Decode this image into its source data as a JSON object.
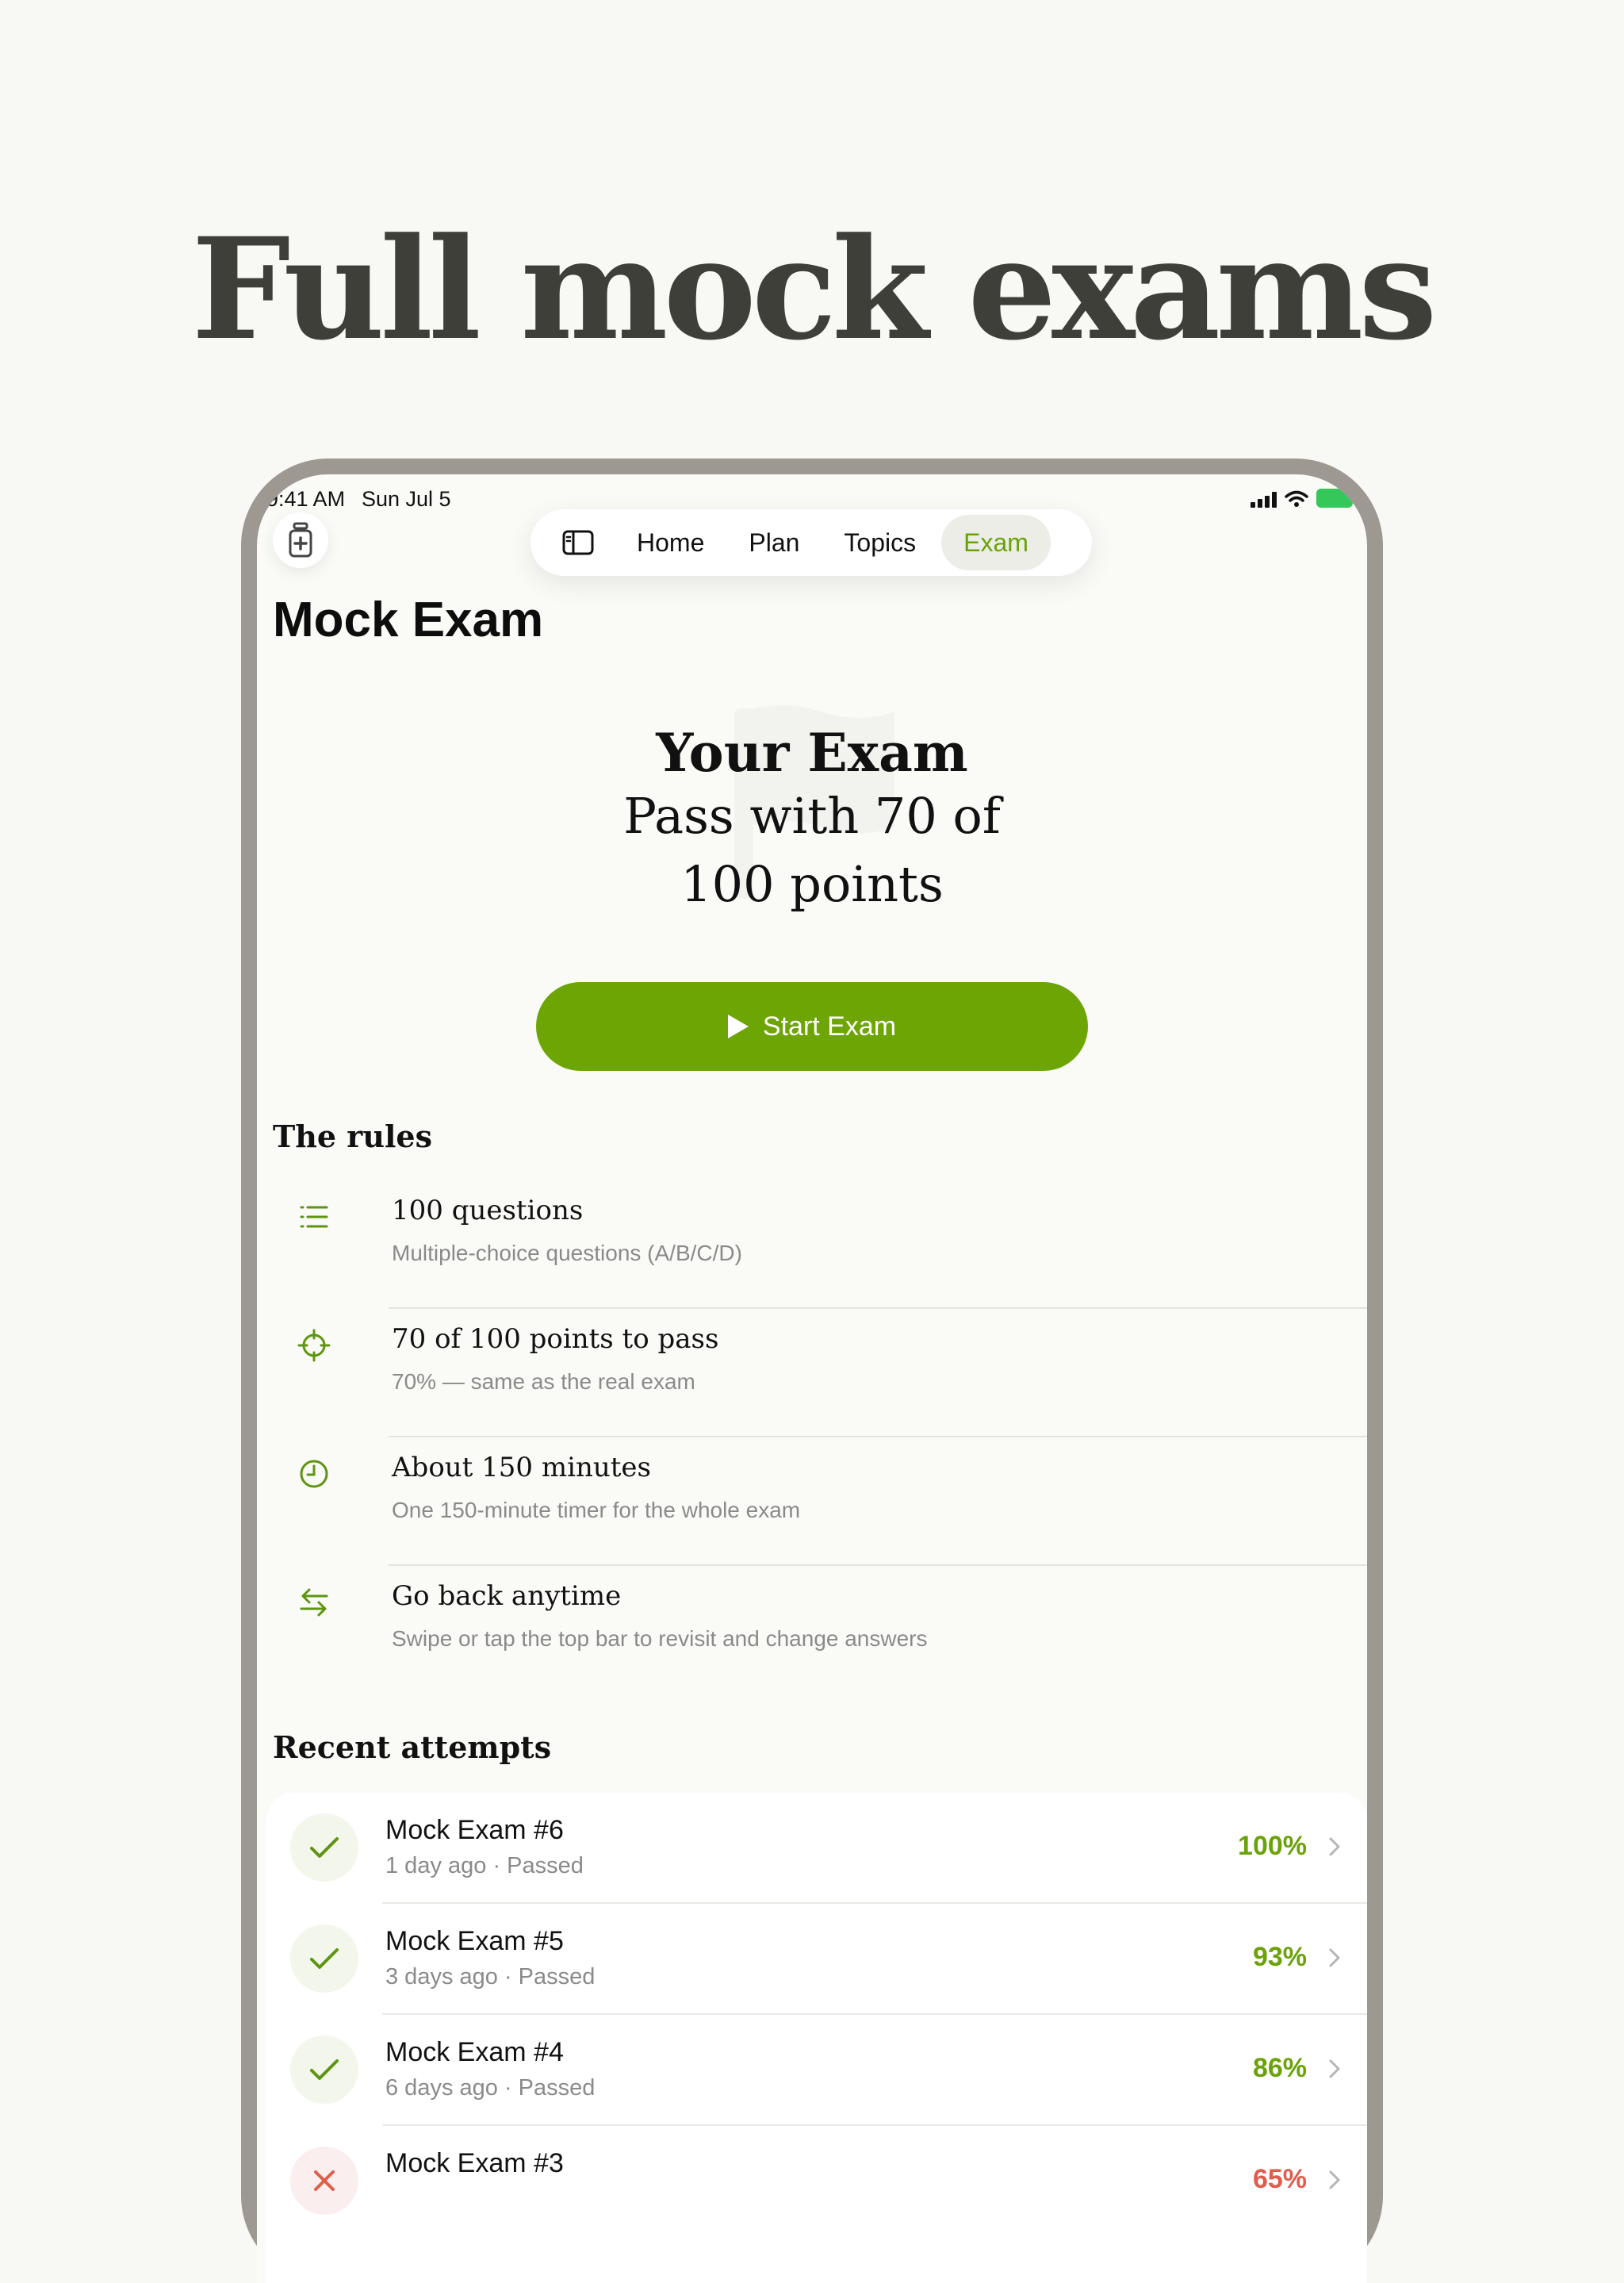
{
  "headline": "Full mock exams",
  "status_bar": {
    "time": "9:41 AM",
    "date": "Sun Jul 5"
  },
  "tabs": [
    {
      "label": "Home"
    },
    {
      "label": "Plan"
    },
    {
      "label": "Topics"
    },
    {
      "label": "Exam"
    }
  ],
  "active_tab": "Exam",
  "page_title": "Mock Exam",
  "hero": {
    "title": "Your Exam",
    "subtitle": "Pass with 70 of 100 points"
  },
  "start_button": "Start Exam",
  "rules": {
    "title": "The rules",
    "items": [
      {
        "icon": "list-icon",
        "title": "100 questions",
        "desc": "Multiple-choice questions (A/B/C/D)"
      },
      {
        "icon": "target-icon",
        "title": "70 of 100 points to pass",
        "desc": "70% — same as the real exam"
      },
      {
        "icon": "clock-icon",
        "title": "About 150 minutes",
        "desc": "One 150-minute timer for the whole exam"
      },
      {
        "icon": "arrows-swap-icon",
        "title": "Go back anytime",
        "desc": "Swipe or tap the top bar to revisit and change answers"
      }
    ]
  },
  "recent": {
    "title": "Recent attempts",
    "items": [
      {
        "name": "Mock Exam #6",
        "meta": "1 day ago · Passed",
        "score": "100%",
        "status": "passed"
      },
      {
        "name": "Mock Exam #5",
        "meta": "3 days ago · Passed",
        "score": "93%",
        "status": "passed"
      },
      {
        "name": "Mock Exam #4",
        "meta": "6 days ago · Passed",
        "score": "86%",
        "status": "passed"
      },
      {
        "name": "Mock Exam #3",
        "meta": "",
        "score": "65%",
        "status": "failed"
      }
    ]
  },
  "colors": {
    "accent": "#6da505",
    "background": "#f8f9f4",
    "fail": "#e05d4b"
  }
}
